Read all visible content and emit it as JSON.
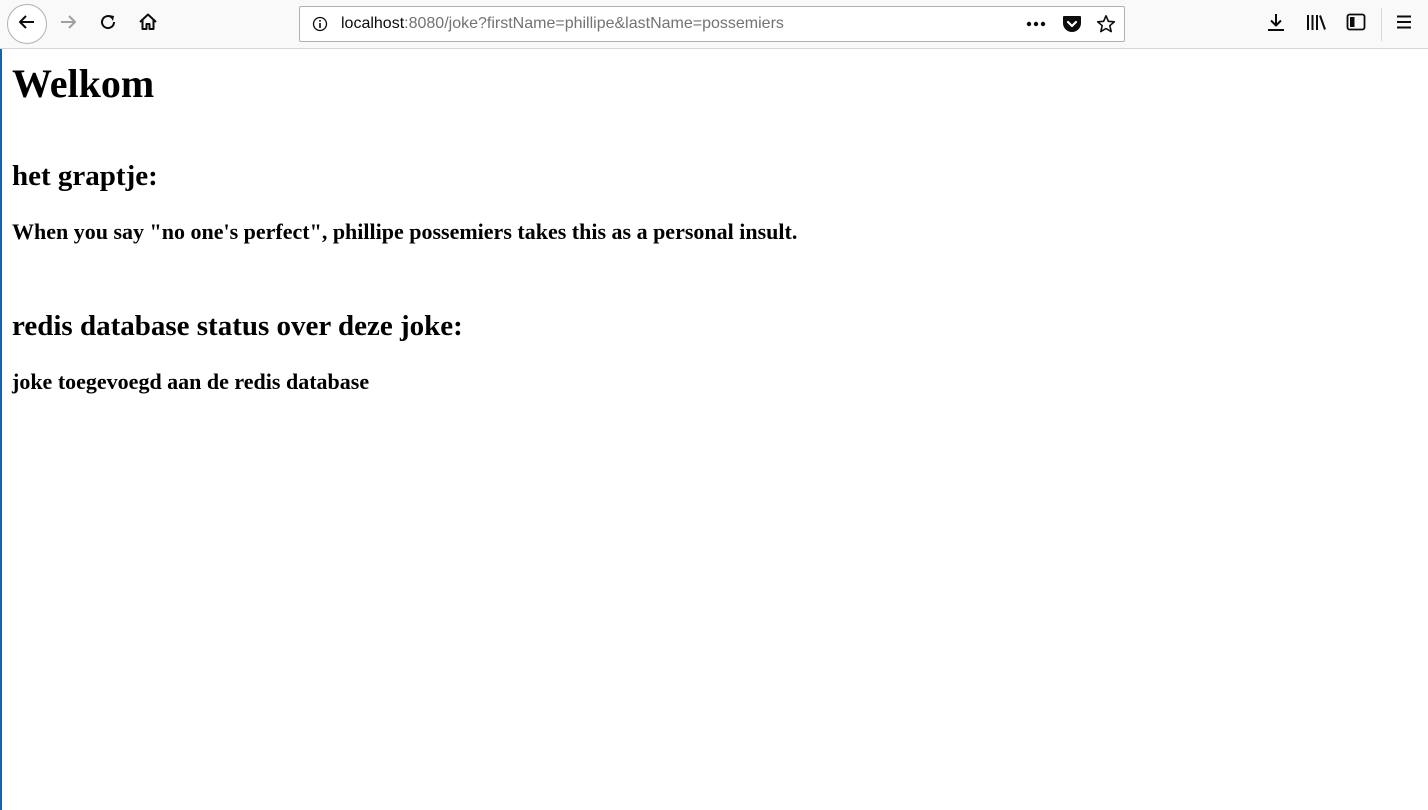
{
  "browser": {
    "url_host": "localhost",
    "url_rest": ":8080/joke?firstName=phillipe&lastName=possemiers",
    "icons": {
      "back": "back-arrow-icon",
      "forward": "forward-arrow-icon",
      "reload": "reload-icon",
      "home": "home-icon",
      "site_info": "info-icon",
      "page_actions": "more-horizontal-icon",
      "pocket": "pocket-icon",
      "bookmark": "star-icon",
      "downloads": "download-icon",
      "library": "library-icon",
      "sidebar": "sidebar-icon",
      "menu": "hamburger-menu-icon"
    }
  },
  "page": {
    "title": "Welkom",
    "joke_heading": "het graptje:",
    "joke_text": "When you say \"no one's perfect\", phillipe possemiers takes this as a personal insult.",
    "status_heading": "redis database status over deze joke:",
    "status_text": "joke toegevoegd aan de redis database"
  }
}
